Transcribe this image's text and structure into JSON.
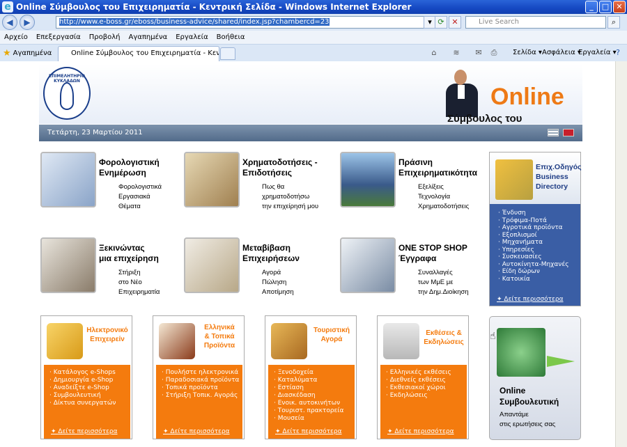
{
  "window": {
    "title": "Online Σύμβουλος του Επιχειρηματία - Κεντρική Σελίδα - Windows Internet Explorer"
  },
  "address": {
    "url": "http://www.e-boss.gr/eboss/business-advice/shared/index.jsp?chambercd=23",
    "search_placeholder": "Live Search"
  },
  "menu": [
    "Αρχείο",
    "Επεξεργασία",
    "Προβολή",
    "Αγαπημένα",
    "Εργαλεία",
    "Βοήθεια"
  ],
  "tabs": {
    "favorites": "Αγαπημένα",
    "active_tab": "Online Σύμβουλος του Επιχειρηματία - Κεντρική Σελίδα"
  },
  "commands": {
    "page": "Σελίδα",
    "safety": "Ασφάλεια",
    "tools": "Εργαλεία"
  },
  "header": {
    "logo_text": "ΕΠΙΜΕΛΗΤΗΡΙΟ ΚΥΚΛΑΔΩΝ",
    "brand": "Online",
    "subtitle": "Σύμβουλος του Επιχειρηματία",
    "date": "Τετάρτη, 23 Μαρτίου 2011"
  },
  "services": [
    {
      "title1": "Φορολογιστική",
      "title2": "Ενημέρωση",
      "desc": [
        "Φορολογιστικά",
        "Εργασιακά",
        "Θέματα"
      ]
    },
    {
      "title1": "Χρηματοδοτήσεις -",
      "title2": "Επιδοτήσεις",
      "desc": [
        "Πως θα",
        "χρηματοδοτήσω",
        "την επιχείρησή μου"
      ]
    },
    {
      "title1": "Πράσινη",
      "title2": "Επιχειρηματικότητα",
      "desc": [
        "Εξελίξεις",
        "Τεχνολογία",
        "Χρηματοδοτήσεις"
      ]
    },
    {
      "title1": "Ξεκινώντας",
      "title2": "μια επιχείρηση",
      "desc": [
        "Στήριξη",
        "στο Νέο",
        "Επιχειρηματία"
      ]
    },
    {
      "title1": "Μεταβίβαση",
      "title2": "Επιχειρήσεων",
      "desc": [
        "Αγορά",
        "Πώληση",
        "Αποτίμηση"
      ]
    },
    {
      "title1": "ONE STOP SHOP",
      "title2": "Έγγραφα",
      "desc": [
        "Συναλλαγές",
        "των ΜμΕ με",
        "την Δημ.Διοίκηση"
      ]
    }
  ],
  "directory": {
    "title": [
      "Επιχ.Οδηγός",
      "Business",
      "Directory"
    ],
    "items": [
      "Ένδυση",
      "Τρόφιμα-Ποτά",
      "Αγροτικά προϊόντα",
      "Εξοπλισμοί",
      "Μηχανήματα",
      "Υπηρεσίες",
      "Συσκευασίες",
      "Αυτοκίνητα-Μηχανές",
      "Είδη δώρων",
      "Κατοικία"
    ],
    "more": "Δείτε περισσότερα"
  },
  "boxes": [
    {
      "title": [
        "Ηλεκτρονικό",
        "Επιχειρείν"
      ],
      "items": [
        "Κατάλογος e-Shops",
        "Δημιουργία e-Shop",
        "Αναδείξτε e-Shop",
        "Συμβουλευτική",
        "Δίκτυα συνεργατών"
      ],
      "more": "Δείτε περισσότερα"
    },
    {
      "title": [
        "Ελληνικά",
        "& Τοπικά",
        "Προϊόντα"
      ],
      "items": [
        "Πουλήστε ηλεκτρονικά",
        "Παραδοσιακά προϊόντα",
        "Τοπικά προϊόντα",
        "Στήριξη Τοπικ. Αγοράς"
      ],
      "more": "Δείτε περισσότερα"
    },
    {
      "title": [
        "Τουριστική",
        "Αγορά"
      ],
      "items": [
        "Ξενοδοχεία",
        "Καταλύματα",
        "Εστίαση",
        "Διασκέδαση",
        "Ενοικ. αυτοκινήτων",
        "Τουριστ. πρακτορεία",
        "Μουσεία"
      ],
      "more": "Δείτε περισσότερα"
    },
    {
      "title": [
        "Εκθέσεις &",
        "Εκδηλώσεις"
      ],
      "items": [
        "Ελληνικές εκθέσεις",
        "Διεθνείς εκθέσεις",
        "Εκθεσιακοί χώροι",
        "Εκδηλώσεις"
      ],
      "more": "Δείτε περισσότερα"
    }
  ],
  "consulting": {
    "title1": "Online",
    "title2": "Συμβουλευτική",
    "desc1": "Απαντάμε",
    "desc2": "στις ερωτήσεις σας"
  }
}
